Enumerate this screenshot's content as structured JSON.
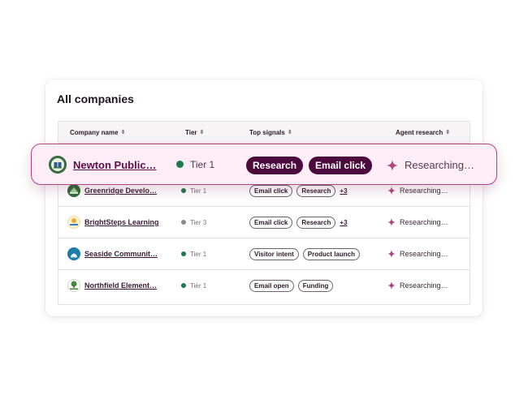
{
  "panel": {
    "title": "All companies"
  },
  "columns": [
    {
      "label": "Company name"
    },
    {
      "label": "Tier"
    },
    {
      "label": "Top signals"
    },
    {
      "label": "Agent research"
    }
  ],
  "highlighted_row": {
    "name": "Newton Public…",
    "tier": "Tier  1",
    "tier_color": "#1e7a4a",
    "signals": [
      "Research",
      "Email click"
    ],
    "agent": "Researching…"
  },
  "rows": [
    {
      "name": "Greenridge Develo…",
      "tier": "Tier 1",
      "signals": [
        "Email click",
        "Research"
      ],
      "more": "+3",
      "agent": "Researching…"
    },
    {
      "name": "BrightSteps Learning",
      "tier": "Tier 3",
      "signals": [
        "Email click",
        "Research"
      ],
      "more": "+3",
      "agent": "Researching…"
    },
    {
      "name": "Seaside Communit…",
      "tier": "Tier 1",
      "signals": [
        "Visitor intent",
        "Product launch"
      ],
      "more": "",
      "agent": "Researching…"
    },
    {
      "name": "Northfield Element…",
      "tier": "Tier 1",
      "signals": [
        "Email open",
        "Funding"
      ],
      "more": "",
      "agent": "Researching…"
    }
  ],
  "colors": {
    "accent": "#b3447f",
    "pill_dark": "#4d0a3d",
    "highlight_bg": "#fcedf6",
    "tier_green": "#1e7a4a",
    "tier_grey": "#8a8a8a"
  },
  "icons": [
    "sort-icon",
    "sparkle-icon",
    "company-logo"
  ]
}
